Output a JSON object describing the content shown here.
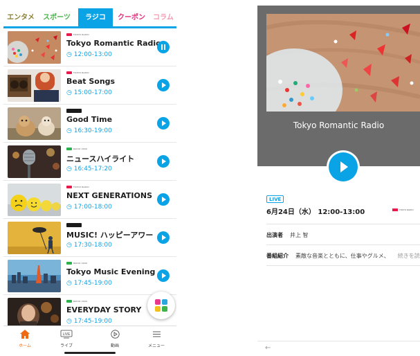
{
  "tabs": [
    {
      "label": "エンタメ",
      "color": "#8a7f2f"
    },
    {
      "label": "スポーツ",
      "color": "#4bb34b"
    },
    {
      "label": "ラジコ",
      "color": "#ffffff",
      "active": true
    },
    {
      "label": "クーポン",
      "color": "#e52b7a"
    },
    {
      "label": "コラム",
      "color": "#f29bb2"
    }
  ],
  "programs": [
    {
      "station": "TOKYO RADIO",
      "logo_color": "#e8194b",
      "title": "Tokyo Romantic Radio",
      "time": "12:00-13:00",
      "state": "pause"
    },
    {
      "station": "TOKYO RADIO",
      "logo_color": "#e8194b",
      "title": "Beat Songs",
      "time": "15:00-17:00",
      "state": "play"
    },
    {
      "station": "",
      "logo_color": "#1a1a1a",
      "title": "Good Time",
      "time": "16:30-19:00",
      "state": "play"
    },
    {
      "station": "RADIO 2020",
      "logo_color": "#2bb24c",
      "title": "ニュースハイライト",
      "time": "16:45-17:20",
      "state": "play"
    },
    {
      "station": "TOKYO RADIO",
      "logo_color": "#e8194b",
      "title": "NEXT GENERATIONS",
      "time": "17:00-18:00",
      "state": "play"
    },
    {
      "station": "",
      "logo_color": "#1a1a1a",
      "title": "MUSIC! ハッピーアワー",
      "time": "17:30-18:00",
      "state": "play"
    },
    {
      "station": "RADIO 2020",
      "logo_color": "#2bb24c",
      "title": "Tokyo Music Evening",
      "time": "17:45-19:00",
      "state": "play"
    },
    {
      "station": "RADIO 2020",
      "logo_color": "#2bb24c",
      "title": "EVERYDAY STORY",
      "time": "17:45-19:00",
      "state": "none"
    }
  ],
  "bottom_nav": [
    {
      "label": "ホーム",
      "icon": "home-icon",
      "active": true
    },
    {
      "label": "ライブ",
      "icon": "live-tv-icon",
      "badge": "LIVE"
    },
    {
      "label": "動画",
      "icon": "video-play-icon"
    },
    {
      "label": "メニュー",
      "icon": "menu-icon"
    }
  ],
  "detail": {
    "hero_title": "Tokyo Romantic Radio",
    "live_badge": "LIVE",
    "datetime": "6月24日（水） 12:00-13:00",
    "station": "TOKYO RADIO",
    "performer_label": "出演者",
    "performer": "井上 智",
    "intro_label": "番組紹介",
    "intro": "素敵な音楽とともに、仕事やグルメ、",
    "more": "続きを読む",
    "back": "←"
  },
  "colors": {
    "accent": "#0aa3e6",
    "home_active": "#f06a13"
  }
}
